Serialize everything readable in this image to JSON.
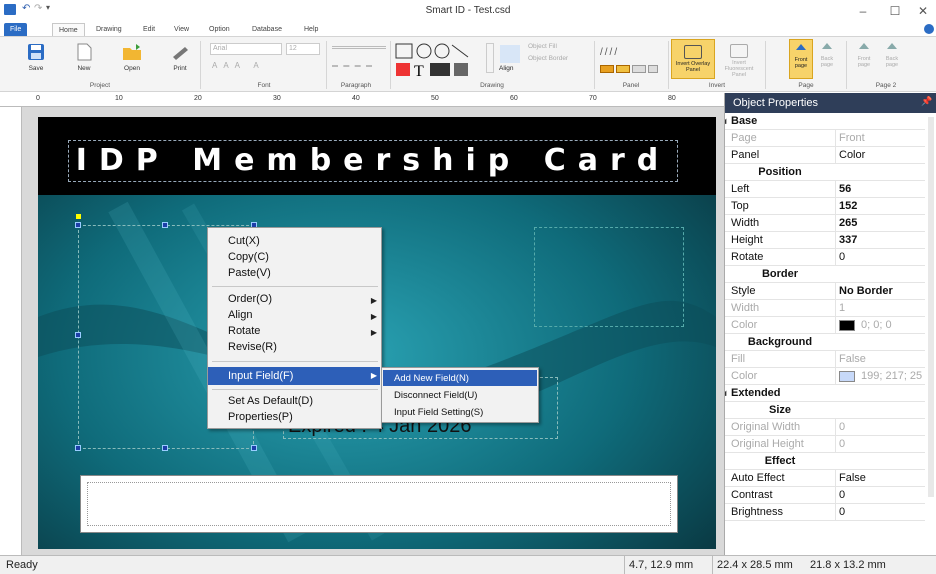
{
  "window": {
    "title": "Smart ID - Test.csd",
    "min": "–",
    "max": "☐",
    "close": "✕"
  },
  "tabs": [
    "File",
    "Home",
    "Drawing",
    "Edit",
    "View",
    "Option",
    "Database",
    "Help"
  ],
  "ribbon": {
    "project": {
      "label": "Project",
      "buttons": [
        "Save",
        "New",
        "Open",
        "Print"
      ]
    },
    "font": {
      "label": "Font",
      "font_name": "Arial",
      "font_size": "12"
    },
    "paragraph": {
      "label": "Paragraph"
    },
    "drawing": {
      "label": "Drawing",
      "align": "Align",
      "object_fill": "Object Fill",
      "object_border": "Object Border"
    },
    "panel": {
      "label": "Panel"
    },
    "invert": {
      "label": "Invert",
      "overlay": "Invert Overlay Panel",
      "fluorescent": "Invert Fluorescent Panel"
    },
    "page": {
      "label": "Page",
      "front": "Front page",
      "back": "Back page"
    },
    "page2": {
      "label": "Page 2",
      "front": "Front page",
      "back": "Back page"
    }
  },
  "ruler_top": [
    "0",
    "10",
    "20",
    "30",
    "40",
    "50",
    "60",
    "70",
    "80"
  ],
  "card": {
    "title": "IDP Membership Card",
    "expiry": "Expired : 4 Jan 2026"
  },
  "context_menu": {
    "items": [
      "Cut(X)",
      "Copy(C)",
      "Paste(V)",
      "Order(O)",
      "Align",
      "Rotate",
      "Revise(R)",
      "Input Field(F)",
      "Set As Default(D)",
      "Properties(P)"
    ]
  },
  "submenu": {
    "items": [
      "Add New Field(N)",
      "Disconnect Field(U)",
      "Input Field Setting(S)"
    ]
  },
  "properties": {
    "header": "Object Properties",
    "pin": "📌",
    "rows": [
      {
        "type": "cat",
        "k": "Base"
      },
      {
        "type": "dim",
        "k": "Page",
        "v": "Front"
      },
      {
        "type": "row",
        "k": "Panel",
        "v": "Color"
      },
      {
        "type": "sub",
        "k": "Position"
      },
      {
        "type": "row",
        "k": "Left",
        "v": "56",
        "bold": true
      },
      {
        "type": "row",
        "k": "Top",
        "v": "152",
        "bold": true
      },
      {
        "type": "row",
        "k": "Width",
        "v": "265",
        "bold": true
      },
      {
        "type": "row",
        "k": "Height",
        "v": "337",
        "bold": true
      },
      {
        "type": "row",
        "k": "Rotate",
        "v": "0"
      },
      {
        "type": "sub",
        "k": "Border"
      },
      {
        "type": "row",
        "k": "Style",
        "v": "No Border",
        "bold": true
      },
      {
        "type": "dim",
        "k": "Width",
        "v": "1"
      },
      {
        "type": "dim",
        "k": "Color",
        "v": "0; 0; 0",
        "swatch": "#000000"
      },
      {
        "type": "sub",
        "k": "Background"
      },
      {
        "type": "dim",
        "k": "Fill",
        "v": "False"
      },
      {
        "type": "dim",
        "k": "Color",
        "v": "199; 217; 25",
        "swatch": "#c7d9f9"
      },
      {
        "type": "cat",
        "k": "Extended"
      },
      {
        "type": "sub",
        "k": "Size"
      },
      {
        "type": "dim",
        "k": "Original Width",
        "v": "0"
      },
      {
        "type": "dim",
        "k": "Original Height",
        "v": "0"
      },
      {
        "type": "sub",
        "k": "Effect"
      },
      {
        "type": "row",
        "k": "Auto Effect",
        "v": "False"
      },
      {
        "type": "row",
        "k": "Contrast",
        "v": "0"
      },
      {
        "type": "row",
        "k": "Brightness",
        "v": "0"
      }
    ]
  },
  "status": {
    "text": "Ready",
    "pos": "4.7, 12.9 mm",
    "size": "22.4 x 28.5 mm",
    "cursor": "21.8 x 13.2 mm"
  },
  "colors": {
    "accent": "#2d5fb8",
    "props_header": "#2f3e59",
    "card_bg": "#0e5f6e"
  }
}
